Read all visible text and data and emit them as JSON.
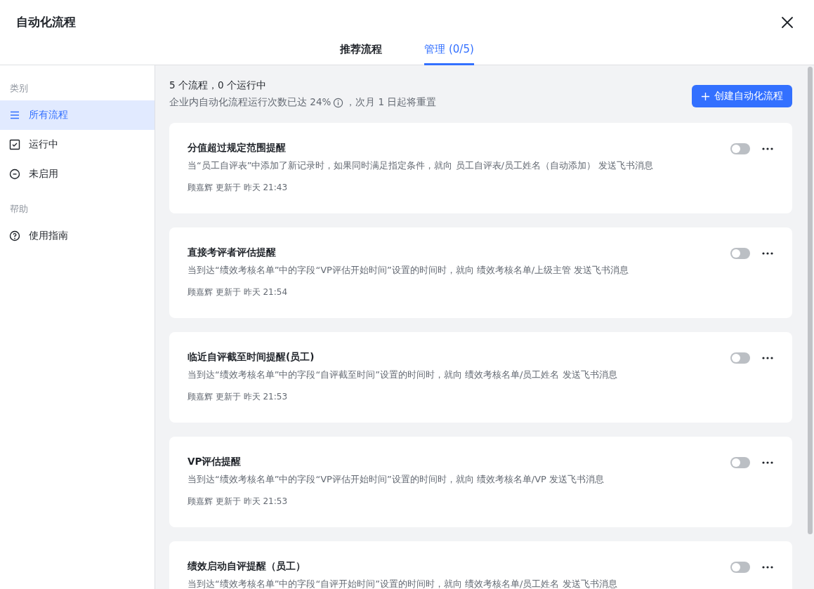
{
  "window": {
    "title": "自动化流程"
  },
  "tabs": [
    {
      "label": "推荐流程",
      "selected": false
    },
    {
      "label": "管理 (0/5)",
      "selected": true
    }
  ],
  "sidebar": {
    "sections": [
      {
        "heading": "类别",
        "items": [
          {
            "label": "所有流程",
            "kind": "list",
            "selected": true
          },
          {
            "label": "运行中",
            "kind": "check",
            "selected": false
          },
          {
            "label": "未启用",
            "kind": "minus",
            "selected": false
          }
        ]
      },
      {
        "heading": "帮助",
        "items": [
          {
            "label": "使用指南",
            "kind": "help",
            "selected": false
          }
        ]
      }
    ]
  },
  "summary": {
    "counts": "5 个流程，0 个运行中",
    "usage_before": "企业内自动化流程运行次数已达 24%",
    "usage_after": "，次月 1 日起将重置"
  },
  "create_button": "创建自动化流程",
  "flows": [
    {
      "title": "分值超过规定范围提醒",
      "description": "当“员工自评表”中添加了新记录时，如果同时满足指定条件，就向 员工自评表/员工姓名（自动添加） 发送飞书消息",
      "meta": "顾嘉辉 更新于 昨天 21:43",
      "on": false
    },
    {
      "title": "直接考评者评估提醒",
      "description": "当到达“绩效考核名单”中的字段“VP评估开始时间”设置的时间时，就向 绩效考核名单/上级主管 发送飞书消息",
      "meta": "顾嘉辉 更新于 昨天 21:54",
      "on": false
    },
    {
      "title": "临近自评截至时间提醒(员工)",
      "description": "当到达“绩效考核名单”中的字段“自评截至时间”设置的时间时，就向 绩效考核名单/员工姓名 发送飞书消息",
      "meta": "顾嘉辉 更新于 昨天 21:53",
      "on": false
    },
    {
      "title": "VP评估提醒",
      "description": "当到达“绩效考核名单”中的字段“VP评估开始时间”设置的时间时，就向 绩效考核名单/VP 发送飞书消息",
      "meta": "顾嘉辉 更新于 昨天 21:53",
      "on": false
    },
    {
      "title": "绩效启动自评提醒（员工）",
      "description": "当到达“绩效考核名单”中的字段“自评开始时间”设置的时间时，就向 绩效考核名单/员工姓名 发送飞书消息",
      "on": false
    }
  ]
}
